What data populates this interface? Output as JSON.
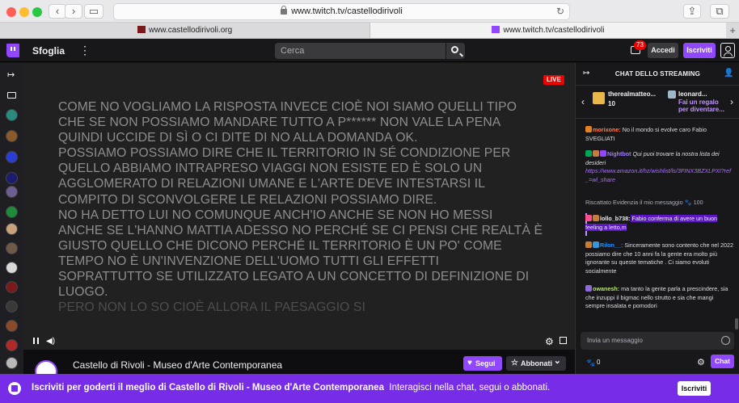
{
  "browser": {
    "url": "www.twitch.tv/castellodirivoli",
    "tabs": [
      "www.castellodirivoli.org",
      "www.twitch.tv/castellodirivoli"
    ]
  },
  "topnav": {
    "browse": "Sfoglia",
    "search_placeholder": "Cerca",
    "notifications": "73",
    "login": "Accedi",
    "signup": "Iscriviti"
  },
  "player": {
    "live_badge": "LIVE",
    "caption_lines": [
      "COME NO VOGLIAMO LA RISPOSTA INVECE CIOÈ NOI SIAMO QUELLI TIPO",
      "CHE SE NON POSSIAMO MANDARE TUTTO A P****** NON VALE LA PENA",
      "QUINDI UCCIDE DI SÌ O CI DITE DI NO ALLA DOMANDA OK.",
      "POSSIAMO POSSIAMO DIRE CHE IL TERRITORIO IN SÉ CONDIZIONE PER",
      "QUELLO ABBIAMO INTRAPRESO VIAGGI NON ESISTE ED È SOLO UN",
      "AGGLOMERATO DI RELAZIONI UMANE E L'ARTE DEVE INTESTARSI IL",
      "COMPITO DI SCONVOLGERE LE RELAZIONI POSSIAMO DIRE.",
      "NO HA DETTO LUI NO COMUNQUE ANCH'IO ANCHE SE NON HO MESSI",
      "ANCHE SE L'HANNO MATTIA ADESSO NO PERCHÉ SE CI PENSI CHE REALTÀ È",
      "GIUSTO QUELLO CHE DICONO PERCHÉ IL TERRITORIO È UN PO' COME",
      "TEMPO NO È UN'INVENZIONE DELL'UOMO TUTTI GLI EFFETTI",
      "SOPRATTUTTO SE UTILIZZATO LEGATO A UN CONCETTO DI DEFINIZIONE DI",
      "LUOGO."
    ],
    "caption_fading": "PERO NON LO SO CIOÈ ALLORA IL PAESAGGIO SI"
  },
  "channel": {
    "title": "Castello di Rivoli - Museo d'Arte Contemporanea",
    "follow": "Segui",
    "subscribe": "Abbonati"
  },
  "chat": {
    "title": "CHAT DELLO STREAMING",
    "gift1": {
      "name": "therealmatteo...",
      "count": "10"
    },
    "gift2": {
      "name": "leonard...",
      "cta": "Fai un regalo per diventare..."
    },
    "messages": [
      {
        "user": "morixone:",
        "user_color": "#ff7f50",
        "text": " No il mondo si evolve caro Fabio SVEGLIATI"
      },
      {
        "user": "Nightbot",
        "user_color": "#9d7cff",
        "text": " Qui puoi trovare la nostra lista dei desideri",
        "link": "https://www.amazon.it/hz/wishlist/ls/3FINX3BZXLPXI?ref_=wl_share"
      },
      {
        "user": "lollo_b738:",
        "user_color": "#efeff1",
        "text": " Fabio conferma di avere un buon feeling a letto,m"
      },
      {
        "user": "Rilon__:",
        "user_color": "#1e90ff",
        "text": " Sinceramente sono contento che nel 2022 possiamo dire che 10 anni fa la gente era molto più ignorante su queste tematiche . Ci siamo evoluti socialmente"
      },
      {
        "user": "owanesh:",
        "user_color": "#b8e37b",
        "text": " ma tanto la gente parla a prescindere, sia che inzuppi il bigmac nello strutto e sia che mangi sempre insalata e pomodori"
      }
    ],
    "redeem": "Riscattato Evidenzia il mio messaggio",
    "redeem_cost": "100",
    "input_placeholder": "Invia un messaggio",
    "points": "0",
    "send": "Chat"
  },
  "banner": {
    "lead": "Iscriviti per goderti il meglio di Castello di Rivoli - Museo d'Arte Contemporanea",
    "rest": "Interagisci nella chat, segui o abbonati.",
    "button": "Iscriviti"
  }
}
